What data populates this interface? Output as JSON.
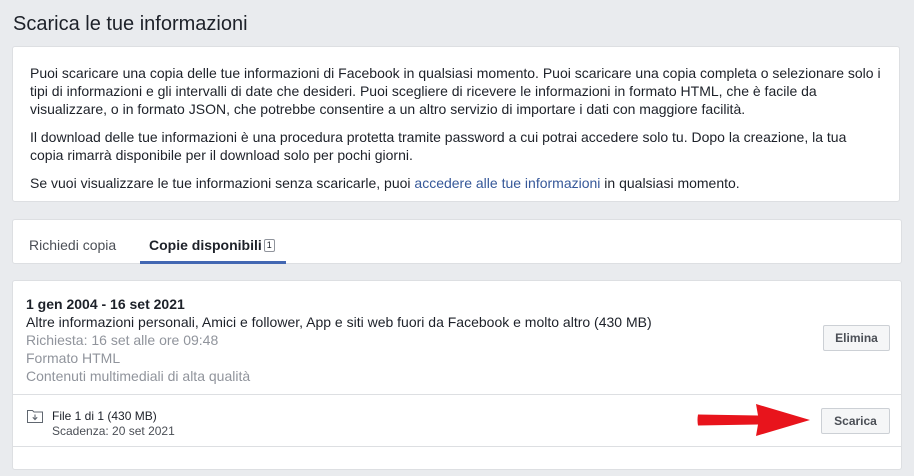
{
  "page": {
    "title": "Scarica le tue informazioni"
  },
  "info": {
    "paragraph1": "Puoi scaricare una copia delle tue informazioni di Facebook in qualsiasi momento. Puoi scaricare una copia completa o selezionare solo i tipi di informazioni e gli intervalli di date che desideri. Puoi scegliere di ricevere le informazioni in formato HTML, che è facile da visualizzare, o in formato JSON, che potrebbe consentire a un altro servizio di importare i dati con maggiore facilità.",
    "paragraph2": "Il download delle tue informazioni è una procedura protetta tramite password a cui potrai accedere solo tu. Dopo la creazione, la tua copia rimarrà disponibile per il download solo per pochi giorni.",
    "paragraph3_before": "Se vuoi visualizzare le tue informazioni senza scaricarle, puoi ",
    "paragraph3_link": "accedere alle tue informazioni",
    "paragraph3_after": " in qualsiasi momento."
  },
  "tabs": {
    "request_label": "Richiedi copia",
    "available_label": "Copie disponibili",
    "available_count": "1"
  },
  "copy": {
    "date_range": "1 gen 2004 - 16 set 2021",
    "contents": "Altre informazioni personali, Amici e follower, App e siti web fuori da Facebook e molto altro (430 MB)",
    "requested": "Richiesta: 16 set alle ore 09:48",
    "format": "Formato HTML",
    "media_quality": "Contenuti multimediali di alta qualità",
    "delete_label": "Elimina",
    "file": {
      "name": "File 1 di 1 (430 MB)",
      "expiry": "Scadenza: 20 set 2021",
      "download_label": "Scarica",
      "icon": "folder-download-icon"
    }
  },
  "colors": {
    "link": "#365899",
    "tab_underline": "#4267b2",
    "annotation_arrow": "#e8141c"
  }
}
